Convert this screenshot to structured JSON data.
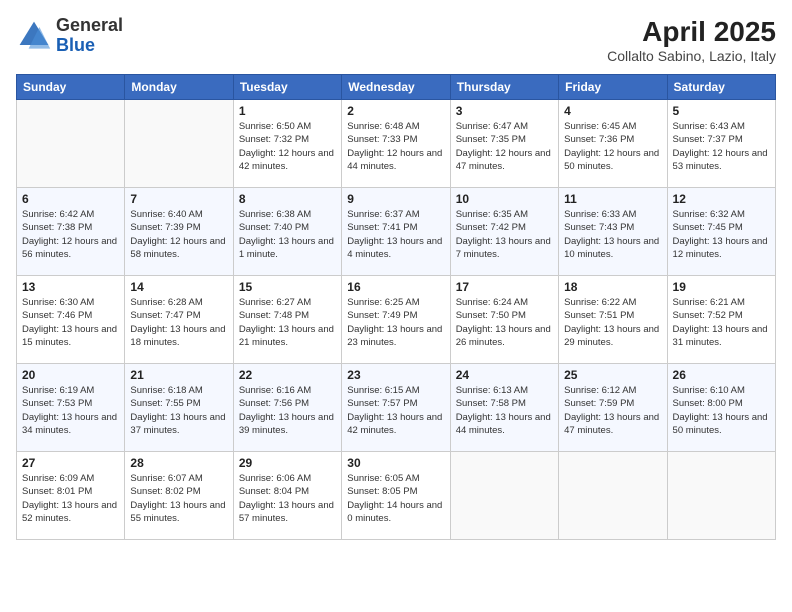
{
  "header": {
    "logo_line1": "General",
    "logo_line2": "Blue",
    "title": "April 2025",
    "subtitle": "Collalto Sabino, Lazio, Italy"
  },
  "weekdays": [
    "Sunday",
    "Monday",
    "Tuesday",
    "Wednesday",
    "Thursday",
    "Friday",
    "Saturday"
  ],
  "weeks": [
    [
      {
        "day": null
      },
      {
        "day": null
      },
      {
        "day": "1",
        "sunrise": "Sunrise: 6:50 AM",
        "sunset": "Sunset: 7:32 PM",
        "daylight": "Daylight: 12 hours and 42 minutes."
      },
      {
        "day": "2",
        "sunrise": "Sunrise: 6:48 AM",
        "sunset": "Sunset: 7:33 PM",
        "daylight": "Daylight: 12 hours and 44 minutes."
      },
      {
        "day": "3",
        "sunrise": "Sunrise: 6:47 AM",
        "sunset": "Sunset: 7:35 PM",
        "daylight": "Daylight: 12 hours and 47 minutes."
      },
      {
        "day": "4",
        "sunrise": "Sunrise: 6:45 AM",
        "sunset": "Sunset: 7:36 PM",
        "daylight": "Daylight: 12 hours and 50 minutes."
      },
      {
        "day": "5",
        "sunrise": "Sunrise: 6:43 AM",
        "sunset": "Sunset: 7:37 PM",
        "daylight": "Daylight: 12 hours and 53 minutes."
      }
    ],
    [
      {
        "day": "6",
        "sunrise": "Sunrise: 6:42 AM",
        "sunset": "Sunset: 7:38 PM",
        "daylight": "Daylight: 12 hours and 56 minutes."
      },
      {
        "day": "7",
        "sunrise": "Sunrise: 6:40 AM",
        "sunset": "Sunset: 7:39 PM",
        "daylight": "Daylight: 12 hours and 58 minutes."
      },
      {
        "day": "8",
        "sunrise": "Sunrise: 6:38 AM",
        "sunset": "Sunset: 7:40 PM",
        "daylight": "Daylight: 13 hours and 1 minute."
      },
      {
        "day": "9",
        "sunrise": "Sunrise: 6:37 AM",
        "sunset": "Sunset: 7:41 PM",
        "daylight": "Daylight: 13 hours and 4 minutes."
      },
      {
        "day": "10",
        "sunrise": "Sunrise: 6:35 AM",
        "sunset": "Sunset: 7:42 PM",
        "daylight": "Daylight: 13 hours and 7 minutes."
      },
      {
        "day": "11",
        "sunrise": "Sunrise: 6:33 AM",
        "sunset": "Sunset: 7:43 PM",
        "daylight": "Daylight: 13 hours and 10 minutes."
      },
      {
        "day": "12",
        "sunrise": "Sunrise: 6:32 AM",
        "sunset": "Sunset: 7:45 PM",
        "daylight": "Daylight: 13 hours and 12 minutes."
      }
    ],
    [
      {
        "day": "13",
        "sunrise": "Sunrise: 6:30 AM",
        "sunset": "Sunset: 7:46 PM",
        "daylight": "Daylight: 13 hours and 15 minutes."
      },
      {
        "day": "14",
        "sunrise": "Sunrise: 6:28 AM",
        "sunset": "Sunset: 7:47 PM",
        "daylight": "Daylight: 13 hours and 18 minutes."
      },
      {
        "day": "15",
        "sunrise": "Sunrise: 6:27 AM",
        "sunset": "Sunset: 7:48 PM",
        "daylight": "Daylight: 13 hours and 21 minutes."
      },
      {
        "day": "16",
        "sunrise": "Sunrise: 6:25 AM",
        "sunset": "Sunset: 7:49 PM",
        "daylight": "Daylight: 13 hours and 23 minutes."
      },
      {
        "day": "17",
        "sunrise": "Sunrise: 6:24 AM",
        "sunset": "Sunset: 7:50 PM",
        "daylight": "Daylight: 13 hours and 26 minutes."
      },
      {
        "day": "18",
        "sunrise": "Sunrise: 6:22 AM",
        "sunset": "Sunset: 7:51 PM",
        "daylight": "Daylight: 13 hours and 29 minutes."
      },
      {
        "day": "19",
        "sunrise": "Sunrise: 6:21 AM",
        "sunset": "Sunset: 7:52 PM",
        "daylight": "Daylight: 13 hours and 31 minutes."
      }
    ],
    [
      {
        "day": "20",
        "sunrise": "Sunrise: 6:19 AM",
        "sunset": "Sunset: 7:53 PM",
        "daylight": "Daylight: 13 hours and 34 minutes."
      },
      {
        "day": "21",
        "sunrise": "Sunrise: 6:18 AM",
        "sunset": "Sunset: 7:55 PM",
        "daylight": "Daylight: 13 hours and 37 minutes."
      },
      {
        "day": "22",
        "sunrise": "Sunrise: 6:16 AM",
        "sunset": "Sunset: 7:56 PM",
        "daylight": "Daylight: 13 hours and 39 minutes."
      },
      {
        "day": "23",
        "sunrise": "Sunrise: 6:15 AM",
        "sunset": "Sunset: 7:57 PM",
        "daylight": "Daylight: 13 hours and 42 minutes."
      },
      {
        "day": "24",
        "sunrise": "Sunrise: 6:13 AM",
        "sunset": "Sunset: 7:58 PM",
        "daylight": "Daylight: 13 hours and 44 minutes."
      },
      {
        "day": "25",
        "sunrise": "Sunrise: 6:12 AM",
        "sunset": "Sunset: 7:59 PM",
        "daylight": "Daylight: 13 hours and 47 minutes."
      },
      {
        "day": "26",
        "sunrise": "Sunrise: 6:10 AM",
        "sunset": "Sunset: 8:00 PM",
        "daylight": "Daylight: 13 hours and 50 minutes."
      }
    ],
    [
      {
        "day": "27",
        "sunrise": "Sunrise: 6:09 AM",
        "sunset": "Sunset: 8:01 PM",
        "daylight": "Daylight: 13 hours and 52 minutes."
      },
      {
        "day": "28",
        "sunrise": "Sunrise: 6:07 AM",
        "sunset": "Sunset: 8:02 PM",
        "daylight": "Daylight: 13 hours and 55 minutes."
      },
      {
        "day": "29",
        "sunrise": "Sunrise: 6:06 AM",
        "sunset": "Sunset: 8:04 PM",
        "daylight": "Daylight: 13 hours and 57 minutes."
      },
      {
        "day": "30",
        "sunrise": "Sunrise: 6:05 AM",
        "sunset": "Sunset: 8:05 PM",
        "daylight": "Daylight: 14 hours and 0 minutes."
      },
      {
        "day": null
      },
      {
        "day": null
      },
      {
        "day": null
      }
    ]
  ]
}
